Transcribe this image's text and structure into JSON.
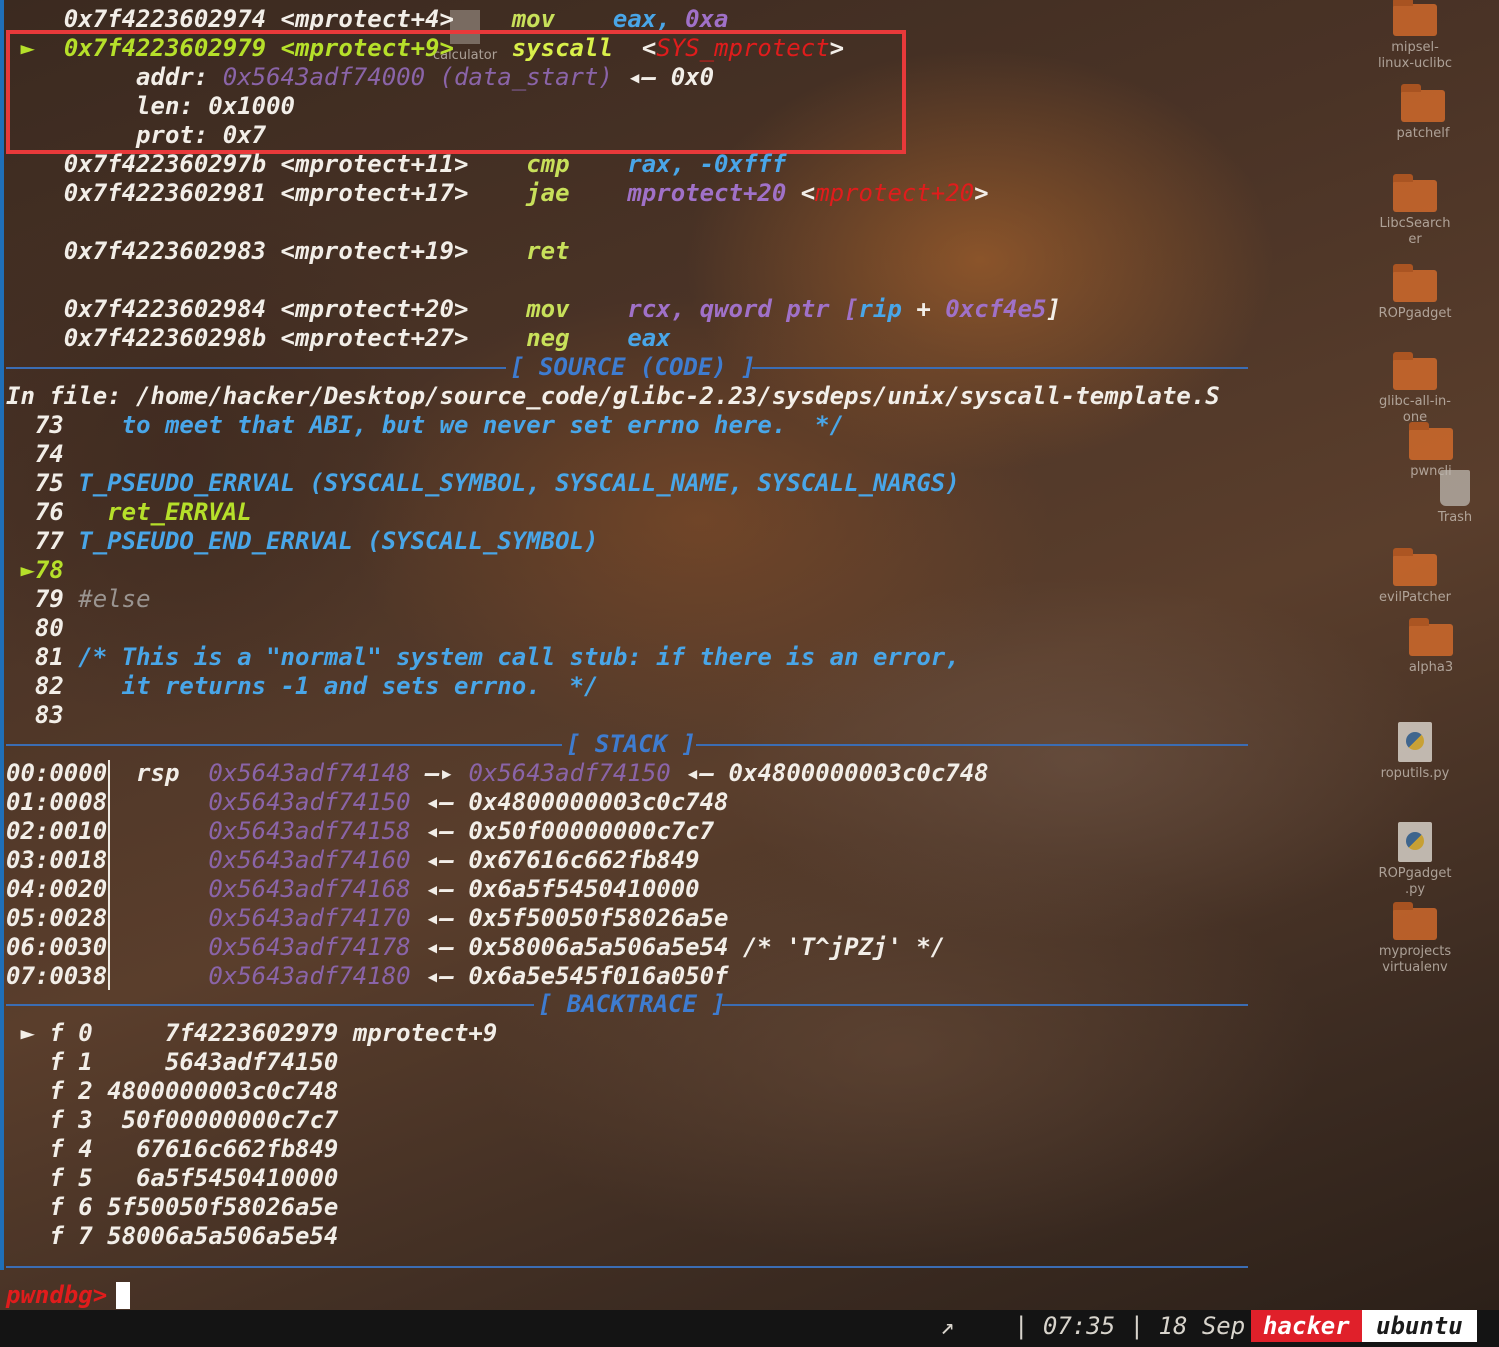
{
  "disasm": {
    "l1": {
      "addr": "0x7f4223602974",
      "sym": "<mprotect+4>",
      "mnem": "mov",
      "ops": "eax,",
      "imm": "0xa"
    },
    "l2": {
      "marker": "►",
      "addr": "0x7f4223602979",
      "sym": "<mprotect+9>",
      "mnem": "syscall",
      "lt": "<",
      "target": "SYS_mprotect",
      "gt": ">"
    },
    "arg_addr": {
      "label": "addr:",
      "val": "0x5643adf74000 (data_start)",
      "arrow": "◂—",
      "res": "0x0"
    },
    "arg_len": {
      "label": "len:",
      "val": "0x1000"
    },
    "arg_prot": {
      "label": "prot:",
      "val": "0x7"
    },
    "l3": {
      "addr": "0x7f422360297b",
      "sym": "<mprotect+11>",
      "mnem": "cmp",
      "ops": "rax, -0xfff"
    },
    "l4": {
      "addr": "0x7f4223602981",
      "sym": "<mprotect+17>",
      "mnem": "jae",
      "ops": "mprotect+20",
      "lt": "<",
      "target": "mprotect+20",
      "gt": ">"
    },
    "l5": {
      "addr": "0x7f4223602983",
      "sym": "<mprotect+19>",
      "mnem": "ret"
    },
    "l6": {
      "addr": "0x7f4223602984",
      "sym": "<mprotect+20>",
      "mnem": "mov",
      "ops1": "rcx, qword ptr [",
      "reg": "rip",
      "plus": " + ",
      "imm": "0xcf4e5",
      "close": "]"
    },
    "l7": {
      "addr": "0x7f422360298b",
      "sym": "<mprotect+27>",
      "mnem": "neg",
      "ops": "eax"
    }
  },
  "source": {
    "header": "[ SOURCE (CODE) ]",
    "file_label": "In file:",
    "file_path": "/home/hacker/Desktop/source_code/glibc-2.23/sysdeps/unix/syscall-template.S",
    "lines": [
      {
        "n": "73",
        "t": "   to meet that ABI, but we never set errno here.  */"
      },
      {
        "n": "74",
        "t": ""
      },
      {
        "n": "75",
        "t": "T_PSEUDO_ERRVAL (SYSCALL_SYMBOL, SYSCALL_NAME, SYSCALL_NARGS)"
      },
      {
        "n": "76",
        "t": "  ret_ERRVAL"
      },
      {
        "n": "77",
        "t": "T_PSEUDO_END_ERRVAL (SYSCALL_SYMBOL)"
      },
      {
        "n": "78",
        "t": "",
        "marker": "►"
      },
      {
        "n": "79",
        "t": "#else"
      },
      {
        "n": "80",
        "t": ""
      },
      {
        "n": "81",
        "t": "/* This is a \"normal\" system call stub: if there is an error,"
      },
      {
        "n": "82",
        "t": "   it returns -1 and sets errno.  */"
      },
      {
        "n": "83",
        "t": ""
      }
    ]
  },
  "stack": {
    "header": "[ STACK ]",
    "rows": [
      {
        "off": "00:0000",
        "reg": "rsp",
        "addr": "0x5643adf74148",
        "a1": "—▸",
        "mid": "0x5643adf74150",
        "a2": "◂—",
        "val": "0x4800000003c0c748"
      },
      {
        "off": "01:0008",
        "reg": "",
        "addr": "0x5643adf74150",
        "a1": "◂—",
        "val": "0x4800000003c0c748"
      },
      {
        "off": "02:0010",
        "reg": "",
        "addr": "0x5643adf74158",
        "a1": "◂—",
        "val": "0x50f00000000c7c7"
      },
      {
        "off": "03:0018",
        "reg": "",
        "addr": "0x5643adf74160",
        "a1": "◂—",
        "val": "0x67616c662fb849"
      },
      {
        "off": "04:0020",
        "reg": "",
        "addr": "0x5643adf74168",
        "a1": "◂—",
        "val": "0x6a5f5450410000"
      },
      {
        "off": "05:0028",
        "reg": "",
        "addr": "0x5643adf74170",
        "a1": "◂—",
        "val": "0x5f50050f58026a5e"
      },
      {
        "off": "06:0030",
        "reg": "",
        "addr": "0x5643adf74178",
        "a1": "◂—",
        "val": "0x58006a5a506a5e54 /* 'T^jPZj' */"
      },
      {
        "off": "07:0038",
        "reg": "",
        "addr": "0x5643adf74180",
        "a1": "◂—",
        "val": "0x6a5e545f016a050f"
      }
    ]
  },
  "backtrace": {
    "header": "[ BACKTRACE ]",
    "frames": [
      {
        "marker": "►",
        "f": "f 0",
        "addr": "    7f4223602979",
        "sym": "mprotect+9"
      },
      {
        "marker": "",
        "f": "f 1",
        "addr": "    5643adf74150",
        "sym": ""
      },
      {
        "marker": "",
        "f": "f 2",
        "addr": "4800000003c0c748",
        "sym": ""
      },
      {
        "marker": "",
        "f": "f 3",
        "addr": " 50f00000000c7c7",
        "sym": ""
      },
      {
        "marker": "",
        "f": "f 4",
        "addr": "  67616c662fb849",
        "sym": ""
      },
      {
        "marker": "",
        "f": "f 5",
        "addr": "  6a5f5450410000",
        "sym": ""
      },
      {
        "marker": "",
        "f": "f 6",
        "addr": "5f50050f58026a5e",
        "sym": ""
      },
      {
        "marker": "",
        "f": "f 7",
        "addr": "58006a5a506a5e54",
        "sym": ""
      }
    ]
  },
  "prompt": {
    "text": "pwndbg>"
  },
  "status": {
    "arrow": "↗",
    "time": "| 07:35 | 18 Sep",
    "user": "hacker",
    "host": "ubuntu"
  },
  "desktop": [
    {
      "name": "calculator",
      "icon": "file-icon"
    },
    {
      "name": "mipsel-\nlinux-uclibc",
      "icon": "folder-icon"
    },
    {
      "name": "patchelf",
      "icon": "folder-icon"
    },
    {
      "name": "LibcSearch\ner",
      "icon": "folder-icon"
    },
    {
      "name": "ROPgadget",
      "icon": "folder-icon"
    },
    {
      "name": "glibc-all-in-\none",
      "icon": "folder-icon"
    },
    {
      "name": "pwncli",
      "icon": "folder-icon"
    },
    {
      "name": "Trash",
      "icon": "trash-icon"
    },
    {
      "name": "evilPatcher",
      "icon": "folder-icon"
    },
    {
      "name": "alpha3",
      "icon": "folder-icon"
    },
    {
      "name": "roputils.py",
      "icon": "python-file-icon"
    },
    {
      "name": "ROPgadget\n.py",
      "icon": "python-file-icon"
    },
    {
      "name": "myprojects\nvirtualenv",
      "icon": "folder-icon"
    }
  ],
  "colors": {
    "accent_blue": "#3b6db4",
    "highlight_red": "#e8393a",
    "green": "#b6e02a",
    "cyan": "#49a6e8",
    "purple": "#a071c8"
  }
}
